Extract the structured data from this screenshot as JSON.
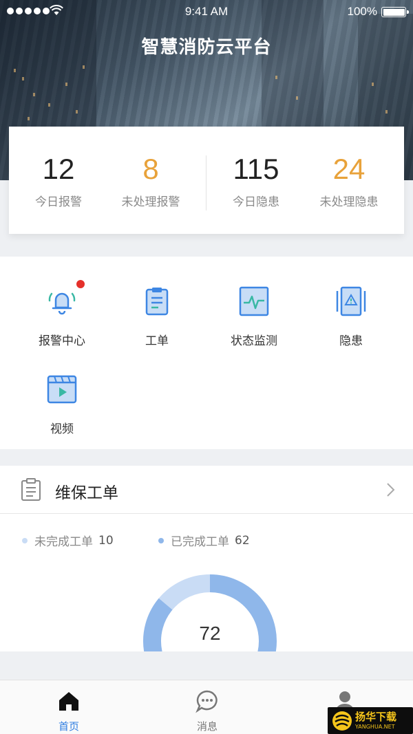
{
  "status_bar": {
    "time": "9:41 AM",
    "battery": "100%"
  },
  "app_title": "智慧消防云平台",
  "stats": [
    {
      "value": "12",
      "label": "今日报警",
      "accent": "#222222"
    },
    {
      "value": "8",
      "label": "未处理报警",
      "accent": "#e8a23a"
    },
    {
      "value": "115",
      "label": "今日隐患",
      "accent": "#222222"
    },
    {
      "value": "24",
      "label": "未处理隐患",
      "accent": "#e8a23a"
    }
  ],
  "menu": [
    {
      "label": "报警中心",
      "icon": "alarm-bell-icon",
      "has_notification": true
    },
    {
      "label": "工单",
      "icon": "clipboard-icon"
    },
    {
      "label": "状态监测",
      "icon": "monitor-pulse-icon"
    },
    {
      "label": "隐患",
      "icon": "hazard-warning-icon"
    },
    {
      "label": "视频",
      "icon": "video-icon"
    }
  ],
  "maintenance": {
    "title": "维保工单",
    "legend": [
      {
        "label": "未完成工单",
        "value": "10",
        "color": "#c9dcf5"
      },
      {
        "label": "已完成工单",
        "value": "62",
        "color": "#8fb7ea"
      }
    ],
    "total": "72"
  },
  "chart_data": {
    "type": "pie",
    "categories": [
      "未完成工单",
      "已完成工单"
    ],
    "values": [
      10,
      62
    ],
    "total": 72
  },
  "tabs": [
    {
      "label": "首页",
      "icon": "home-icon",
      "active": true
    },
    {
      "label": "消息",
      "icon": "message-icon",
      "active": false
    },
    {
      "label": "",
      "icon": "profile-icon",
      "active": false
    }
  ],
  "watermark": {
    "cn": "扬华下载",
    "en": "YANGHUA.NET"
  },
  "colors": {
    "accent_blue": "#2f7de1",
    "orange": "#e8a23a",
    "alert_red": "#e5302a"
  }
}
